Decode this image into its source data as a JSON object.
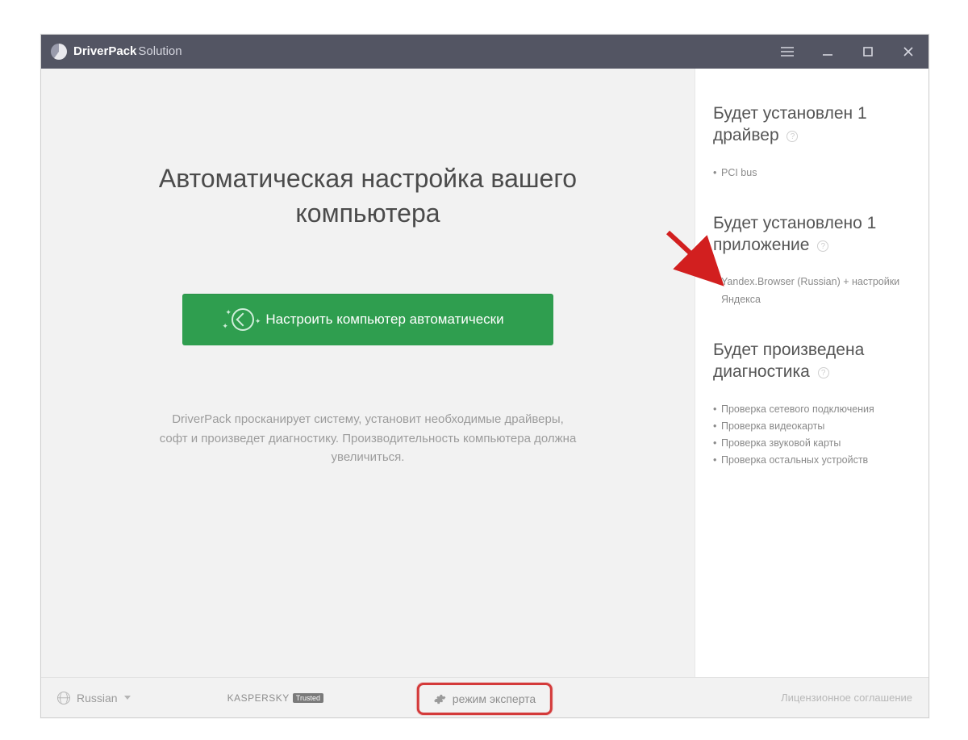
{
  "brand": {
    "bold": "DriverPack",
    "light": "Solution"
  },
  "main": {
    "headline": "Автоматическая настройка вашего компьютера",
    "cta_label": "Настроить компьютер автоматически",
    "description": "DriverPack просканирует систему, установит необходимые драйверы, софт и произведет диагностику. Производительность компьютера должна увеличиться."
  },
  "sidebar": {
    "drivers": {
      "title": "Будет установлен 1 драйвер",
      "items": [
        "PCI bus"
      ]
    },
    "apps": {
      "title": "Будет установлено 1 приложение",
      "items": [
        "Yandex.Browser (Russian) + настройки Яндекса"
      ]
    },
    "diag": {
      "title": "Будет произведена диагностика",
      "items": [
        "Проверка сетевого подключения",
        "Проверка видеокарты",
        "Проверка звуковой карты",
        "Проверка остальных устройств"
      ]
    }
  },
  "footer": {
    "language": "Russian",
    "kaspersky": "KASPERSKY",
    "kaspersky_badge": "Trusted",
    "expert_mode": "режим эксперта",
    "license": "Лицензионное соглашение"
  }
}
